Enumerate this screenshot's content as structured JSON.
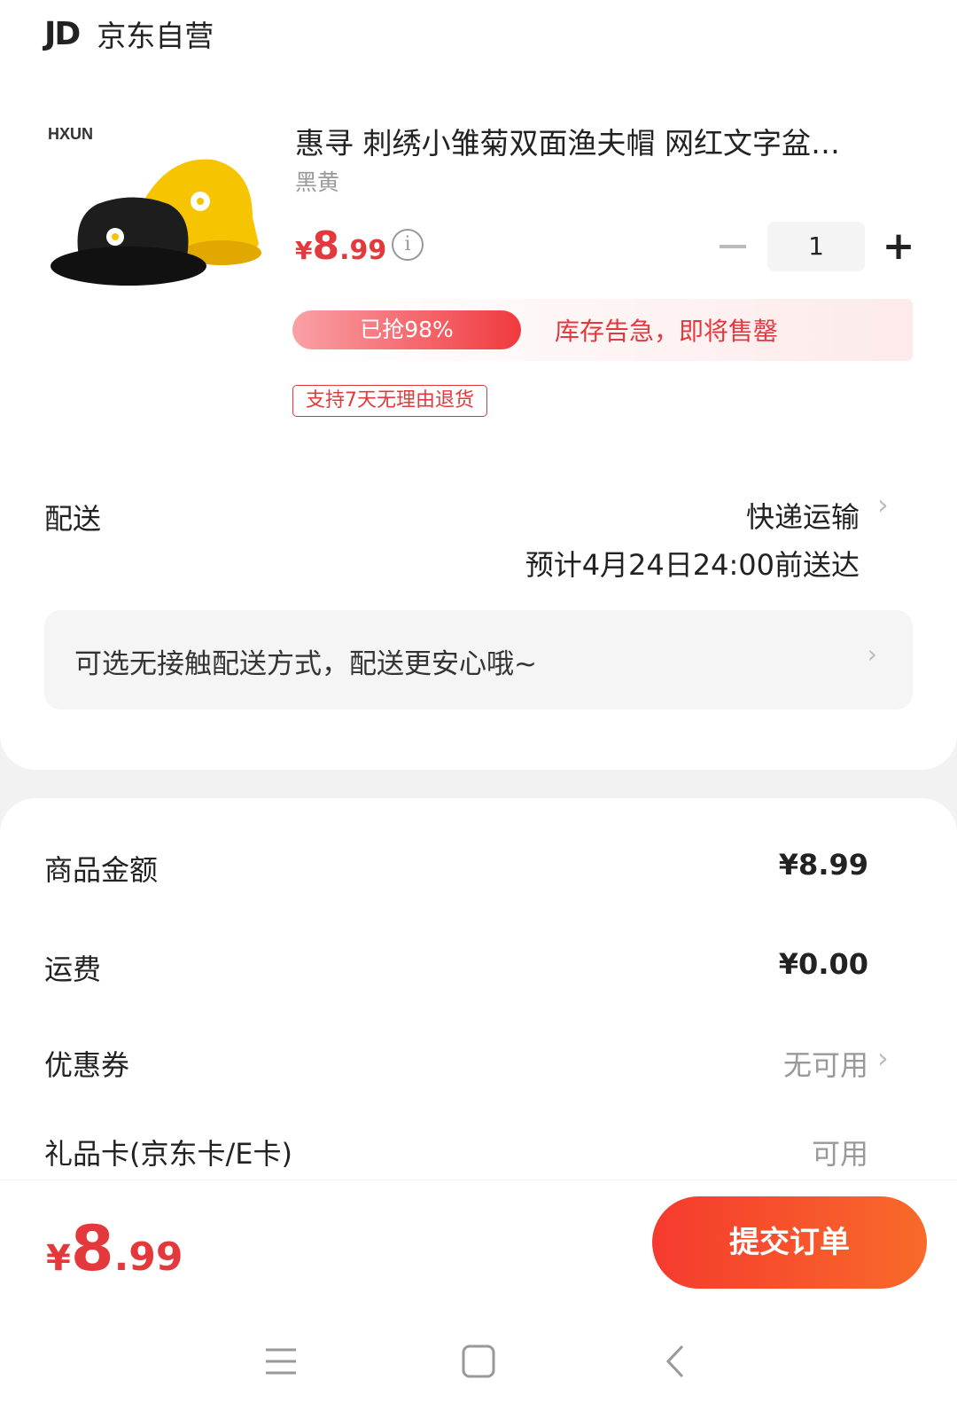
{
  "shop": {
    "logo_text": "JD",
    "name": "京东自营"
  },
  "product": {
    "brand_logo_text": "HXUN",
    "title": "惠寻 刺绣小雏菊双面渔夫帽 网红文字盆…",
    "variant": "黑黄",
    "price": {
      "currency": "¥",
      "int": "8",
      "dec": ".99"
    },
    "quantity": "1",
    "sold_label": "已抢98%",
    "sold_fraction": 0.98,
    "stock_warning": "库存告急，即将售罄",
    "return_policy": "支持7天无理由退货"
  },
  "delivery": {
    "label": "配送",
    "method": "快递运输",
    "eta": "预计4月24日24:00前送达",
    "no_contact_tip": "可选无接触配送方式，配送更安心哦~"
  },
  "summary": {
    "goods_amount_label": "商品金额",
    "goods_amount": "¥8.99",
    "shipping_label": "运费",
    "shipping": "¥0.00",
    "coupon_label": "优惠券",
    "coupon_value": "无可用",
    "giftcard_label": "礼品卡(京东卡/E卡)",
    "giftcard_value": "可用"
  },
  "footer": {
    "total": {
      "currency": "¥",
      "int": "8",
      "dec": ".99"
    },
    "submit_label": "提交订单"
  },
  "icons": {
    "chevron": "chevron-right-icon",
    "info": "info-icon",
    "nav_menu": "menu-icon",
    "nav_home": "home-icon",
    "nav_back": "back-icon"
  },
  "colors": {
    "accent": "#e4393c",
    "button": "#f63a2e"
  }
}
